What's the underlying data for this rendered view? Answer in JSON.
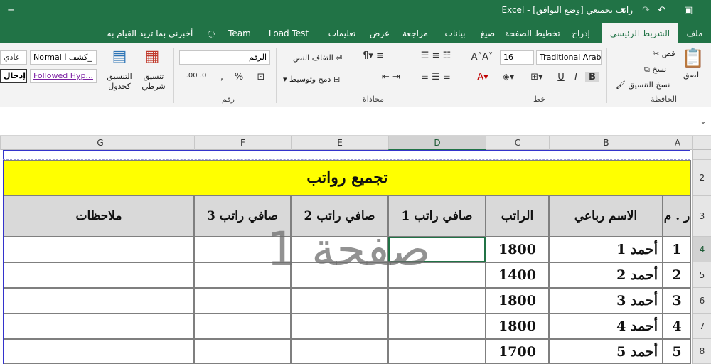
{
  "titlebar": {
    "title": "راتب تجميعي  [وضع التوافق]  -  Excel"
  },
  "tabs": [
    {
      "label": "ملف"
    },
    {
      "label": "الشريط الرئيسي"
    },
    {
      "label": "إدراج"
    },
    {
      "label": "تخطيط الصفحة"
    },
    {
      "label": "صيغ"
    },
    {
      "label": "بيانات"
    },
    {
      "label": "مراجعة"
    },
    {
      "label": "عرض"
    },
    {
      "label": "تعليمات"
    },
    {
      "label": "Load Test"
    },
    {
      "label": "Team"
    },
    {
      "label": "أخبرني بما تريد القيام به"
    }
  ],
  "ribbon": {
    "clipboard": {
      "paste": "لصق",
      "cut": "قص",
      "copy": "نسخ",
      "format_painter": "نسخ التنسيق",
      "group": "الحافظة"
    },
    "font": {
      "name": "Traditional Arabic",
      "size": "16",
      "bold": "B",
      "italic": "I",
      "underline": "U",
      "group": "خط"
    },
    "alignment": {
      "wrap": "التفاف النص",
      "merge": "دمج وتوسيط",
      "group": "محاذاة"
    },
    "number": {
      "format": "الرقم",
      "percent": "%",
      "comma": ",",
      "group": "رقم"
    },
    "styles": {
      "conditional": "تنسيق شرطي",
      "as_table": "التنسيق كجدول",
      "normal": "Normal",
      "hyperlink_name": "كشف ا_",
      "normal_ar": "عادي",
      "followed": "Followed Hyp...",
      "input": "إدخال"
    }
  },
  "columns": [
    "A",
    "B",
    "C",
    "D",
    "E",
    "F",
    "G"
  ],
  "rows": [
    "2",
    "3",
    "4",
    "5",
    "6",
    "7",
    "8"
  ],
  "sheet": {
    "title": "تجميع رواتب",
    "headers": {
      "no": "ر . م",
      "name": "الاسم رباعي",
      "salary": "الراتب",
      "net1": "صافي راتب 1",
      "net2": "صافي راتب 2",
      "net3": "صافي راتب 3",
      "notes": "ملاحظات"
    },
    "data": [
      {
        "no": "1",
        "name": "أحمد 1",
        "salary": "1800"
      },
      {
        "no": "2",
        "name": "أحمد 2",
        "salary": "1400"
      },
      {
        "no": "3",
        "name": "أحمد 3",
        "salary": "1800"
      },
      {
        "no": "4",
        "name": "أحمد 4",
        "salary": "1800"
      },
      {
        "no": "5",
        "name": "أحمد 5",
        "salary": "1700"
      }
    ],
    "watermark": "صفحة 1"
  },
  "colors": {
    "excel_green": "#217346",
    "title_fill": "#ffff00",
    "header_fill": "#d9d9d9",
    "page_border": "#3333cc"
  }
}
